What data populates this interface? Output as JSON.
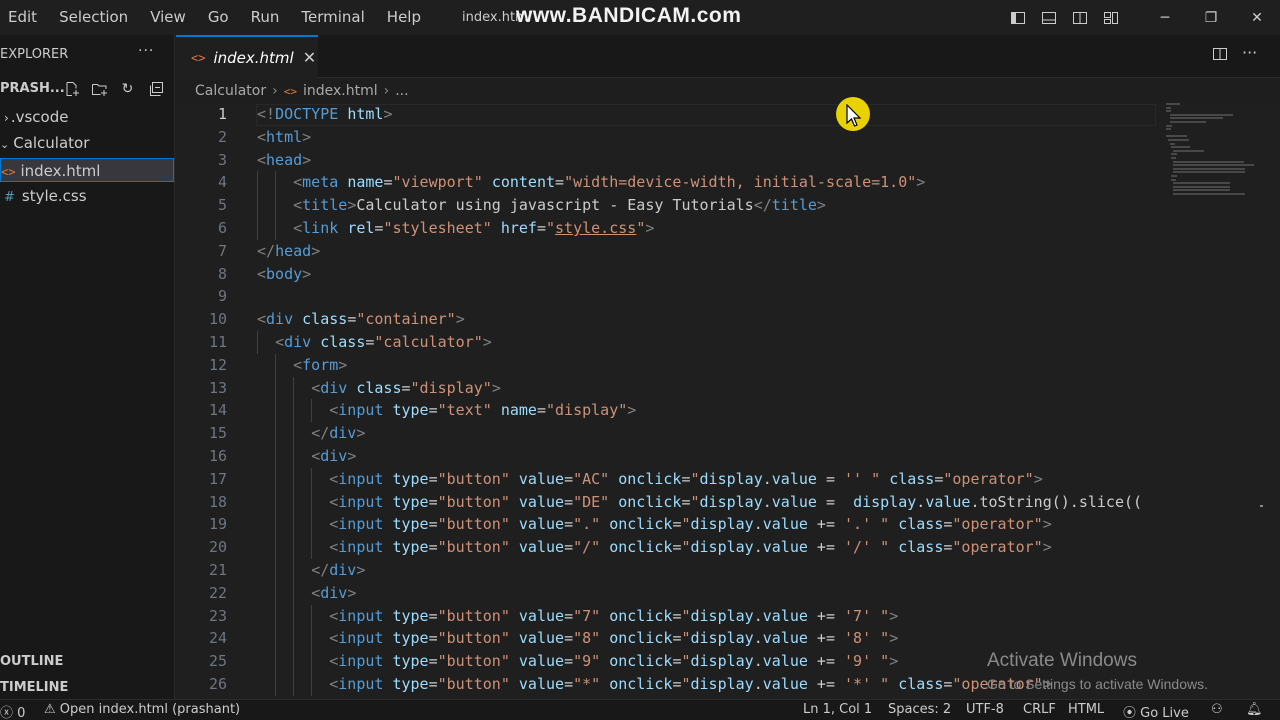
{
  "menu": [
    "Edit",
    "Selection",
    "View",
    "Go",
    "Run",
    "Terminal",
    "Help"
  ],
  "window_title": "index.html",
  "watermark": "www.BANDICAM.com",
  "sidebar": {
    "explorer_title": "EXPLORER",
    "project": "PRASH...",
    "tree": [
      {
        "label": ".vscode",
        "kind": "folder-collapsed"
      },
      {
        "label": "Calculator",
        "kind": "folder-open"
      },
      {
        "label": "index.html",
        "kind": "html",
        "selected": true
      },
      {
        "label": "style.css",
        "kind": "css"
      }
    ],
    "outline": "OUTLINE",
    "timeline": "TIMELINE"
  },
  "tab": {
    "label": "index.html"
  },
  "breadcrumb": {
    "folder": "Calculator",
    "file": "index.html",
    "more": "..."
  },
  "editor": {
    "active_line": 1,
    "lines": [
      [
        [
          "punc",
          "<!"
        ],
        [
          "tag",
          "DOCTYPE "
        ],
        [
          "attr",
          "html"
        ],
        [
          "punc",
          ">"
        ]
      ],
      [
        [
          "punc",
          "<"
        ],
        [
          "tag",
          "html"
        ],
        [
          "punc",
          ">"
        ]
      ],
      [
        [
          "punc",
          "<"
        ],
        [
          "tag",
          "head"
        ],
        [
          "punc",
          ">"
        ]
      ],
      [
        [
          "text",
          "    "
        ],
        [
          "punc",
          "<"
        ],
        [
          "tag",
          "meta "
        ],
        [
          "attr",
          "name"
        ],
        [
          "text",
          "="
        ],
        [
          "str",
          "\"viewport\""
        ],
        [
          "text",
          " "
        ],
        [
          "attr",
          "content"
        ],
        [
          "text",
          "="
        ],
        [
          "str",
          "\"width=device-width, initial-scale=1.0\""
        ],
        [
          "punc",
          ">"
        ]
      ],
      [
        [
          "text",
          "    "
        ],
        [
          "punc",
          "<"
        ],
        [
          "tag",
          "title"
        ],
        [
          "punc",
          ">"
        ],
        [
          "text",
          "Calculator using javascript - Easy Tutorials"
        ],
        [
          "punc",
          "</"
        ],
        [
          "tag",
          "title"
        ],
        [
          "punc",
          ">"
        ]
      ],
      [
        [
          "text",
          "    "
        ],
        [
          "punc",
          "<"
        ],
        [
          "tag",
          "link "
        ],
        [
          "attr",
          "rel"
        ],
        [
          "text",
          "="
        ],
        [
          "str",
          "\"stylesheet\""
        ],
        [
          "text",
          " "
        ],
        [
          "attr",
          "href"
        ],
        [
          "text",
          "="
        ],
        [
          "str",
          "\""
        ],
        [
          "link",
          "style.css"
        ],
        [
          "str",
          "\""
        ],
        [
          "punc",
          ">"
        ]
      ],
      [
        [
          "punc",
          "</"
        ],
        [
          "tag",
          "head"
        ],
        [
          "punc",
          ">"
        ]
      ],
      [
        [
          "punc",
          "<"
        ],
        [
          "tag",
          "body"
        ],
        [
          "punc",
          ">"
        ]
      ],
      [],
      [
        [
          "punc",
          "<"
        ],
        [
          "tag",
          "div "
        ],
        [
          "attr",
          "class"
        ],
        [
          "text",
          "="
        ],
        [
          "str",
          "\"container\""
        ],
        [
          "punc",
          ">"
        ]
      ],
      [
        [
          "text",
          "  "
        ],
        [
          "punc",
          "<"
        ],
        [
          "tag",
          "div "
        ],
        [
          "attr",
          "class"
        ],
        [
          "text",
          "="
        ],
        [
          "str",
          "\"calculator\""
        ],
        [
          "punc",
          ">"
        ]
      ],
      [
        [
          "text",
          "    "
        ],
        [
          "punc",
          "<"
        ],
        [
          "tag",
          "form"
        ],
        [
          "punc",
          ">"
        ]
      ],
      [
        [
          "text",
          "      "
        ],
        [
          "punc",
          "<"
        ],
        [
          "tag",
          "div "
        ],
        [
          "attr",
          "class"
        ],
        [
          "text",
          "="
        ],
        [
          "str",
          "\"display\""
        ],
        [
          "punc",
          ">"
        ]
      ],
      [
        [
          "text",
          "        "
        ],
        [
          "punc",
          "<"
        ],
        [
          "tag",
          "input "
        ],
        [
          "attr",
          "type"
        ],
        [
          "text",
          "="
        ],
        [
          "str",
          "\"text\""
        ],
        [
          "text",
          " "
        ],
        [
          "attr",
          "name"
        ],
        [
          "text",
          "="
        ],
        [
          "str",
          "\"display\""
        ],
        [
          "punc",
          ">"
        ]
      ],
      [
        [
          "text",
          "      "
        ],
        [
          "punc",
          "</"
        ],
        [
          "tag",
          "div"
        ],
        [
          "punc",
          ">"
        ]
      ],
      [
        [
          "text",
          "      "
        ],
        [
          "punc",
          "<"
        ],
        [
          "tag",
          "div"
        ],
        [
          "punc",
          ">"
        ]
      ],
      [
        [
          "text",
          "        "
        ],
        [
          "punc",
          "<"
        ],
        [
          "tag",
          "input "
        ],
        [
          "attr",
          "type"
        ],
        [
          "text",
          "="
        ],
        [
          "str",
          "\"button\""
        ],
        [
          "text",
          " "
        ],
        [
          "attr",
          "value"
        ],
        [
          "text",
          "="
        ],
        [
          "str",
          "\"AC\""
        ],
        [
          "text",
          " "
        ],
        [
          "attr",
          "onclick"
        ],
        [
          "text",
          "="
        ],
        [
          "str",
          "\""
        ],
        [
          "attr",
          "display"
        ],
        [
          "text",
          "."
        ],
        [
          "attr",
          "value"
        ],
        [
          "text",
          " = "
        ],
        [
          "str",
          "'' \""
        ],
        [
          "text",
          " "
        ],
        [
          "attr",
          "class"
        ],
        [
          "text",
          "="
        ],
        [
          "str",
          "\"operator\""
        ],
        [
          "punc",
          ">"
        ]
      ],
      [
        [
          "text",
          "        "
        ],
        [
          "punc",
          "<"
        ],
        [
          "tag",
          "input "
        ],
        [
          "attr",
          "type"
        ],
        [
          "text",
          "="
        ],
        [
          "str",
          "\"button\""
        ],
        [
          "text",
          " "
        ],
        [
          "attr",
          "value"
        ],
        [
          "text",
          "="
        ],
        [
          "str",
          "\"DE\""
        ],
        [
          "text",
          " "
        ],
        [
          "attr",
          "onclick"
        ],
        [
          "text",
          "="
        ],
        [
          "str",
          "\""
        ],
        [
          "attr",
          "display"
        ],
        [
          "text",
          "."
        ],
        [
          "attr",
          "value"
        ],
        [
          "text",
          " =  "
        ],
        [
          "attr",
          "display"
        ],
        [
          "text",
          "."
        ],
        [
          "attr",
          "value"
        ],
        [
          "text",
          "."
        ],
        [
          "text",
          "toString"
        ],
        [
          "text",
          "()."
        ],
        [
          "text",
          "slice"
        ],
        [
          "text",
          "(("
        ]
      ],
      [
        [
          "text",
          "        "
        ],
        [
          "punc",
          "<"
        ],
        [
          "tag",
          "input "
        ],
        [
          "attr",
          "type"
        ],
        [
          "text",
          "="
        ],
        [
          "str",
          "\"button\""
        ],
        [
          "text",
          " "
        ],
        [
          "attr",
          "value"
        ],
        [
          "text",
          "="
        ],
        [
          "str",
          "\".\""
        ],
        [
          "text",
          " "
        ],
        [
          "attr",
          "onclick"
        ],
        [
          "text",
          "="
        ],
        [
          "str",
          "\""
        ],
        [
          "attr",
          "display"
        ],
        [
          "text",
          "."
        ],
        [
          "attr",
          "value"
        ],
        [
          "text",
          " += "
        ],
        [
          "str",
          "'.' \""
        ],
        [
          "text",
          " "
        ],
        [
          "attr",
          "class"
        ],
        [
          "text",
          "="
        ],
        [
          "str",
          "\"operator\""
        ],
        [
          "punc",
          ">"
        ]
      ],
      [
        [
          "text",
          "        "
        ],
        [
          "punc",
          "<"
        ],
        [
          "tag",
          "input "
        ],
        [
          "attr",
          "type"
        ],
        [
          "text",
          "="
        ],
        [
          "str",
          "\"button\""
        ],
        [
          "text",
          " "
        ],
        [
          "attr",
          "value"
        ],
        [
          "text",
          "="
        ],
        [
          "str",
          "\"/\""
        ],
        [
          "text",
          " "
        ],
        [
          "attr",
          "onclick"
        ],
        [
          "text",
          "="
        ],
        [
          "str",
          "\""
        ],
        [
          "attr",
          "display"
        ],
        [
          "text",
          "."
        ],
        [
          "attr",
          "value"
        ],
        [
          "text",
          " += "
        ],
        [
          "str",
          "'/' \""
        ],
        [
          "text",
          " "
        ],
        [
          "attr",
          "class"
        ],
        [
          "text",
          "="
        ],
        [
          "str",
          "\"operator\""
        ],
        [
          "punc",
          ">"
        ]
      ],
      [
        [
          "text",
          "      "
        ],
        [
          "punc",
          "</"
        ],
        [
          "tag",
          "div"
        ],
        [
          "punc",
          ">"
        ]
      ],
      [
        [
          "text",
          "      "
        ],
        [
          "punc",
          "<"
        ],
        [
          "tag",
          "div"
        ],
        [
          "punc",
          ">"
        ]
      ],
      [
        [
          "text",
          "        "
        ],
        [
          "punc",
          "<"
        ],
        [
          "tag",
          "input "
        ],
        [
          "attr",
          "type"
        ],
        [
          "text",
          "="
        ],
        [
          "str",
          "\"button\""
        ],
        [
          "text",
          " "
        ],
        [
          "attr",
          "value"
        ],
        [
          "text",
          "="
        ],
        [
          "str",
          "\"7\""
        ],
        [
          "text",
          " "
        ],
        [
          "attr",
          "onclick"
        ],
        [
          "text",
          "="
        ],
        [
          "str",
          "\""
        ],
        [
          "attr",
          "display"
        ],
        [
          "text",
          "."
        ],
        [
          "attr",
          "value"
        ],
        [
          "text",
          " += "
        ],
        [
          "str",
          "'7' \""
        ],
        [
          "punc",
          ">"
        ]
      ],
      [
        [
          "text",
          "        "
        ],
        [
          "punc",
          "<"
        ],
        [
          "tag",
          "input "
        ],
        [
          "attr",
          "type"
        ],
        [
          "text",
          "="
        ],
        [
          "str",
          "\"button\""
        ],
        [
          "text",
          " "
        ],
        [
          "attr",
          "value"
        ],
        [
          "text",
          "="
        ],
        [
          "str",
          "\"8\""
        ],
        [
          "text",
          " "
        ],
        [
          "attr",
          "onclick"
        ],
        [
          "text",
          "="
        ],
        [
          "str",
          "\""
        ],
        [
          "attr",
          "display"
        ],
        [
          "text",
          "."
        ],
        [
          "attr",
          "value"
        ],
        [
          "text",
          " += "
        ],
        [
          "str",
          "'8' \""
        ],
        [
          "punc",
          ">"
        ]
      ],
      [
        [
          "text",
          "        "
        ],
        [
          "punc",
          "<"
        ],
        [
          "tag",
          "input "
        ],
        [
          "attr",
          "type"
        ],
        [
          "text",
          "="
        ],
        [
          "str",
          "\"button\""
        ],
        [
          "text",
          " "
        ],
        [
          "attr",
          "value"
        ],
        [
          "text",
          "="
        ],
        [
          "str",
          "\"9\""
        ],
        [
          "text",
          " "
        ],
        [
          "attr",
          "onclick"
        ],
        [
          "text",
          "="
        ],
        [
          "str",
          "\""
        ],
        [
          "attr",
          "display"
        ],
        [
          "text",
          "."
        ],
        [
          "attr",
          "value"
        ],
        [
          "text",
          " += "
        ],
        [
          "str",
          "'9' \""
        ],
        [
          "punc",
          ">"
        ]
      ],
      [
        [
          "text",
          "        "
        ],
        [
          "punc",
          "<"
        ],
        [
          "tag",
          "input "
        ],
        [
          "attr",
          "type"
        ],
        [
          "text",
          "="
        ],
        [
          "str",
          "\"button\""
        ],
        [
          "text",
          " "
        ],
        [
          "attr",
          "value"
        ],
        [
          "text",
          "="
        ],
        [
          "str",
          "\"*\""
        ],
        [
          "text",
          " "
        ],
        [
          "attr",
          "onclick"
        ],
        [
          "text",
          "="
        ],
        [
          "str",
          "\""
        ],
        [
          "attr",
          "display"
        ],
        [
          "text",
          "."
        ],
        [
          "attr",
          "value"
        ],
        [
          "text",
          " += "
        ],
        [
          "str",
          "'*' \""
        ],
        [
          "text",
          " "
        ],
        [
          "attr",
          "class"
        ],
        [
          "text",
          "="
        ],
        [
          "str",
          "\"operator\""
        ],
        [
          "punc",
          ">"
        ]
      ]
    ]
  },
  "activate_windows": {
    "title": "Activate Windows",
    "subtitle": "Go to Settings to activate Windows."
  },
  "status": {
    "problems": "0",
    "remote": "Open index.html (prashant)",
    "position": "Ln 1, Col 1",
    "spaces": "Spaces: 2",
    "encoding": "UTF-8",
    "eol": "CRLF",
    "language": "HTML",
    "golive": "Go Live"
  },
  "colors": {
    "accent": "#0078d4",
    "tag": "#569cd6",
    "attr": "#9cdcfe",
    "string": "#ce9178"
  }
}
